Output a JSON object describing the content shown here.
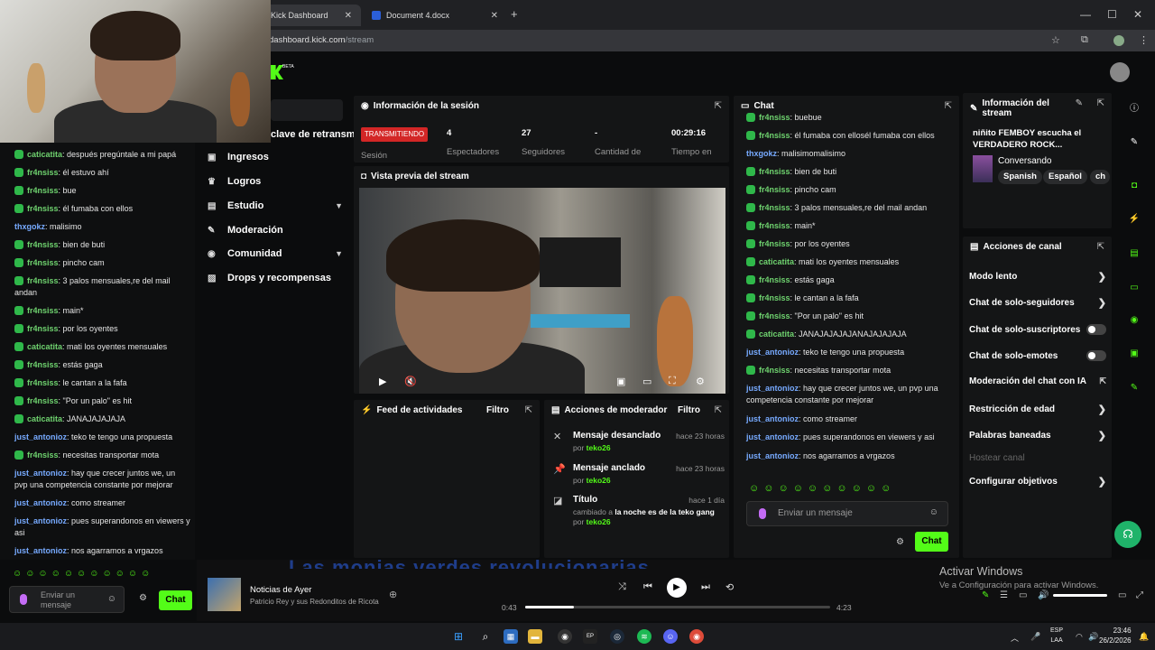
{
  "browser": {
    "tabs": [
      {
        "label": "Kick Dashboard",
        "close": "✕"
      },
      {
        "label": "Document 4.docx",
        "close": "✕"
      }
    ],
    "new_tab": "+",
    "url_host": "dashboard.kick.com",
    "url_path": "/stream",
    "window_controls": {
      "minimize": "—",
      "maximize": "☐",
      "close": "✕"
    }
  },
  "app": {
    "logo_badge": "BETA",
    "accent": "#53fc18"
  },
  "sidenav": {
    "stream_key_label": "clave de retransm",
    "items": [
      {
        "label": "Ingresos",
        "icon": "wallet-icon"
      },
      {
        "label": "Logros",
        "icon": "trophy-icon"
      },
      {
        "label": "Estudio",
        "icon": "studio-icon",
        "expandable": true
      },
      {
        "label": "Moderación",
        "icon": "wrench-icon"
      },
      {
        "label": "Comunidad",
        "icon": "community-icon",
        "expandable": true
      },
      {
        "label": "Drops y recompensas",
        "icon": "gift-icon"
      }
    ]
  },
  "left_chat": {
    "messages": [
      {
        "user": "caticatita",
        "text": "después pregúntale a mi papá",
        "color": "green",
        "badge": true
      },
      {
        "user": "fr4nsiss",
        "text": "él estuvo ahí",
        "color": "green",
        "badge": true
      },
      {
        "user": "fr4nsiss",
        "text": "bue",
        "color": "green",
        "badge": true
      },
      {
        "user": "fr4nsiss",
        "text": "él fumaba con ellos",
        "color": "green",
        "badge": true
      },
      {
        "user": "thxgokz",
        "text": "malisimo",
        "color": "blue",
        "badge": false
      },
      {
        "user": "fr4nsiss",
        "text": "bien de buti",
        "color": "green",
        "badge": true
      },
      {
        "user": "fr4nsiss",
        "text": "pincho cam",
        "color": "green",
        "badge": true
      },
      {
        "user": "fr4nsiss",
        "text": "3 palos mensuales,re del mail andan",
        "color": "green",
        "badge": true
      },
      {
        "user": "fr4nsiss",
        "text": "main*",
        "color": "green",
        "badge": true
      },
      {
        "user": "fr4nsiss",
        "text": "por los oyentes",
        "color": "green",
        "badge": true
      },
      {
        "user": "caticatita",
        "text": "mati los oyentes mensuales",
        "color": "green",
        "badge": true
      },
      {
        "user": "fr4nsiss",
        "text": "estás gaga",
        "color": "green",
        "badge": true
      },
      {
        "user": "fr4nsiss",
        "text": "le cantan a la fafa",
        "color": "green",
        "badge": true
      },
      {
        "user": "fr4nsiss",
        "text": "\"Por un palo\" es hit",
        "color": "green",
        "badge": true
      },
      {
        "user": "caticatita",
        "text": "JANAJAJAJAJA",
        "color": "green",
        "badge": true
      },
      {
        "user": "just_antonioz",
        "text": "teko te tengo una propuesta",
        "color": "blue",
        "badge": false
      },
      {
        "user": "fr4nsiss",
        "text": "necesitas transportar mota",
        "color": "green",
        "badge": true
      },
      {
        "user": "just_antonioz",
        "text": "hay que crecer juntos we, un pvp una competencia constante por mejorar",
        "color": "blue",
        "badge": false
      },
      {
        "user": "just_antonioz",
        "text": "como streamer",
        "color": "blue",
        "badge": false
      },
      {
        "user": "just_antonioz",
        "text": "pues superandonos en viewers y asi",
        "color": "blue",
        "badge": false
      },
      {
        "user": "just_antonioz",
        "text": "nos agarramos a vrgazos",
        "color": "blue",
        "badge": false
      }
    ],
    "emotes": "☺☺☺☺☺☺☺☺☺☺☺",
    "input_placeholder": "Enviar un mensaje",
    "send_label": "Chat"
  },
  "session": {
    "title": "Información de la sesión",
    "status": "TRANSMITIENDO",
    "status_label": "Sesión",
    "stats": [
      {
        "value": "4",
        "label": "Espectadores"
      },
      {
        "value": "27",
        "label": "Seguidores"
      },
      {
        "value": "-",
        "label": "Cantidad de"
      },
      {
        "value": "00:29:16",
        "label": "Tiempo en"
      }
    ]
  },
  "preview": {
    "title": "Vista previa del stream"
  },
  "feed": {
    "title": "Feed de actividades",
    "filter": "Filtro"
  },
  "mod_actions": {
    "title": "Acciones de moderador",
    "filter": "Filtro",
    "items": [
      {
        "title": "Mensaje desanclado",
        "when": "hace 23 horas",
        "by_prefix": "por",
        "by": "teko26",
        "icon": "unpin-icon"
      },
      {
        "title": "Mensaje anclado",
        "when": "hace 23 horas",
        "by_prefix": "por",
        "by": "teko26",
        "icon": "pin-icon"
      },
      {
        "title": "Título",
        "when": "hace 1 día",
        "changed_prefix": "cambiado a",
        "changed_to": "la noche es de la teko gang",
        "by_prefix": "por",
        "by": "teko26",
        "icon": "user-edit-icon"
      }
    ]
  },
  "chat": {
    "title": "Chat",
    "messages": [
      {
        "user": "fr4nsiss",
        "text": "buebue",
        "color": "green",
        "badge": true
      },
      {
        "user": "fr4nsiss",
        "text": "él fumaba con ellosél fumaba con ellos",
        "color": "green",
        "badge": true
      },
      {
        "user": "thxgokz",
        "text": "malisimomalisimo",
        "color": "blue",
        "badge": false
      },
      {
        "user": "fr4nsiss",
        "text": "bien de buti",
        "color": "green",
        "badge": true
      },
      {
        "user": "fr4nsiss",
        "text": "pincho cam",
        "color": "green",
        "badge": true
      },
      {
        "user": "fr4nsiss",
        "text": "3 palos mensuales,re del mail andan",
        "color": "green",
        "badge": true
      },
      {
        "user": "fr4nsiss",
        "text": "main*",
        "color": "green",
        "badge": true
      },
      {
        "user": "fr4nsiss",
        "text": "por los oyentes",
        "color": "green",
        "badge": true
      },
      {
        "user": "caticatita",
        "text": "mati los oyentes mensuales",
        "color": "green",
        "badge": true
      },
      {
        "user": "fr4nsiss",
        "text": "estás gaga",
        "color": "green",
        "badge": true
      },
      {
        "user": "fr4nsiss",
        "text": "le cantan a la fafa",
        "color": "green",
        "badge": true
      },
      {
        "user": "fr4nsiss",
        "text": "\"Por un palo\" es hit",
        "color": "green",
        "badge": true
      },
      {
        "user": "caticatita",
        "text": "JANAJAJAJAJANAJAJAJAJA",
        "color": "green",
        "badge": true
      },
      {
        "user": "just_antonioz",
        "text": "teko te tengo una propuesta",
        "color": "blue",
        "badge": false
      },
      {
        "user": "fr4nsiss",
        "text": "necesitas transportar mota",
        "color": "green",
        "badge": true
      },
      {
        "user": "just_antonioz",
        "text": "hay que crecer juntos we, un pvp una competencia constante por mejorar",
        "color": "blue",
        "badge": false
      },
      {
        "user": "just_antonioz",
        "text": "como streamer",
        "color": "blue",
        "badge": false
      },
      {
        "user": "just_antonioz",
        "text": "pues superandonos en viewers y asi",
        "color": "blue",
        "badge": false
      },
      {
        "user": "just_antonioz",
        "text": "nos agarramos a vrgazos",
        "color": "blue",
        "badge": false
      }
    ],
    "emotes": "☺☺☺☺☺☺☺☺☺☺",
    "input_placeholder": "Enviar un mensaje",
    "send_label": "Chat"
  },
  "stream_info": {
    "title": "Información del stream",
    "stream_title": "niñito FEMBOY escucha el VERDADERO ROCK...",
    "category": "Conversando",
    "tags": [
      "Spanish",
      "Español",
      "ch"
    ]
  },
  "channel_actions": {
    "title": "Acciones de canal",
    "items": [
      {
        "label": "Modo lento",
        "control": "chevron"
      },
      {
        "label": "Chat de solo-seguidores",
        "control": "chevron"
      },
      {
        "label": "Chat de solo-suscriptores",
        "control": "toggle",
        "on": false
      },
      {
        "label": "Chat de solo-emotes",
        "control": "toggle",
        "on": false
      },
      {
        "label": "Moderación del chat con IA",
        "control": "external"
      },
      {
        "label": "Restricción de edad",
        "control": "chevron"
      },
      {
        "label": "Palabras baneadas",
        "control": "chevron"
      },
      {
        "label": "Hostear canal",
        "control": "none",
        "disabled": true
      },
      {
        "label": "Configurar objetivos",
        "control": "chevron"
      }
    ]
  },
  "right_rail_icons": [
    "info-icon",
    "pencil-icon",
    "camera-icon",
    "bolt-icon",
    "notes-icon",
    "chat-icon",
    "broadcast-icon",
    "server-icon",
    "wrench-icon"
  ],
  "player": {
    "background_text": "Las monjas verdes revolucionarias",
    "song": "Noticias de Ayer",
    "artist": "Patricio Rey y sus Redonditos de Ricota",
    "current_time": "0:43",
    "total_time": "4:23",
    "progress": 0.16
  },
  "watermark": {
    "line1": "Activar Windows",
    "line2": "Ve a Configuración para activar Windows."
  },
  "taskbar": {
    "lang_line1": "ESP",
    "lang_line2": "LAA",
    "time": "23:46",
    "date": "26/2/2026"
  }
}
